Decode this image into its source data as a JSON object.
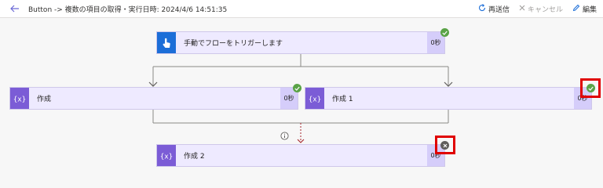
{
  "header": {
    "title": "Button -> 複数の項目の取得・実行日時: 2024/4/6 14:51:35",
    "resubmit_label": "再送信",
    "cancel_label": "キャンセル",
    "edit_label": "編集"
  },
  "flow": {
    "trigger": {
      "label": "手動でフローをトリガーします",
      "duration": "0秒",
      "status": "succeeded"
    },
    "compose": {
      "label": "作成",
      "duration": "0秒",
      "status": "succeeded"
    },
    "compose1": {
      "label": "作成 1",
      "duration": "0秒",
      "status": "succeeded"
    },
    "compose2": {
      "label": "作成 2",
      "duration": "0秒",
      "status": "failed"
    }
  },
  "colors": {
    "accent": "#1c6ed8",
    "compose_icon": "#7b5cd6",
    "success": "#5aa347",
    "failed": "#605e5c",
    "highlight": "#e00000"
  }
}
